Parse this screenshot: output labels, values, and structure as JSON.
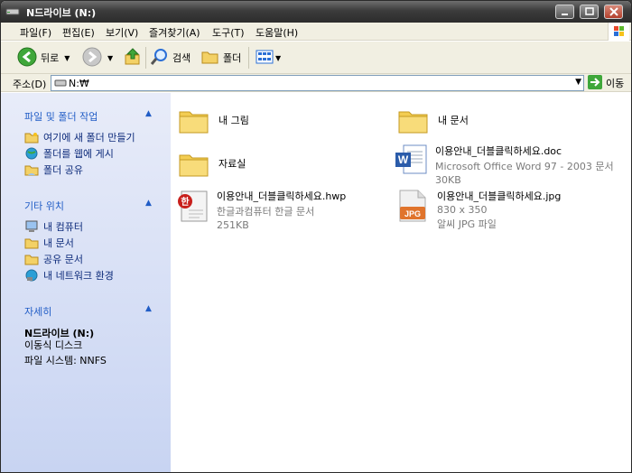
{
  "window": {
    "title": "N드라이브 (N:)"
  },
  "menu": [
    "파일(F)",
    "편집(E)",
    "보기(V)",
    "즐겨찾기(A)",
    "도구(T)",
    "도움말(H)"
  ],
  "toolbar": {
    "back_label": "뒤로",
    "search_label": "검색",
    "folders_label": "폴더"
  },
  "address": {
    "label": "주소(D)",
    "path": "N:₩",
    "go_label": "이동"
  },
  "taskpane": {
    "file_tasks": {
      "title": "파일 및 폴더 작업",
      "items": [
        "여기에 새 폴더 만들기",
        "폴더를 웹에 게시",
        "폴더 공유"
      ]
    },
    "other_places": {
      "title": "기타 위치",
      "items": [
        "내 컴퓨터",
        "내 문서",
        "공유 문서",
        "내 네트워크 환경"
      ]
    },
    "details": {
      "title": "자세히",
      "name": "N드라이브 (N:)",
      "type": "이동식 디스크",
      "fs": "파일 시스템: NNFS"
    }
  },
  "files": [
    {
      "name": "내 그림",
      "icon": "folder-icon"
    },
    {
      "name": "내 문서",
      "icon": "folder-icon"
    },
    {
      "name": "자료실",
      "icon": "folder-icon"
    },
    {
      "name": "이용안내_더블클릭하세요.doc",
      "type": "Microsoft Office Word 97 - 2003 문서",
      "size": "30KB",
      "icon": "word-doc-icon"
    },
    {
      "name": "이용안내_더블클릭하세요.hwp",
      "type": "한글과컴퓨터 한글 문서",
      "size": "251KB",
      "icon": "hwp-doc-icon"
    },
    {
      "name": "이용안내_더블클릭하세요.jpg",
      "type": "830 x 350",
      "size": "알씨 JPG 파일",
      "icon": "jpg-file-icon"
    }
  ],
  "colors": {
    "taskpane_heading": "#215dc6",
    "titlebar": "#3c3c3c"
  }
}
